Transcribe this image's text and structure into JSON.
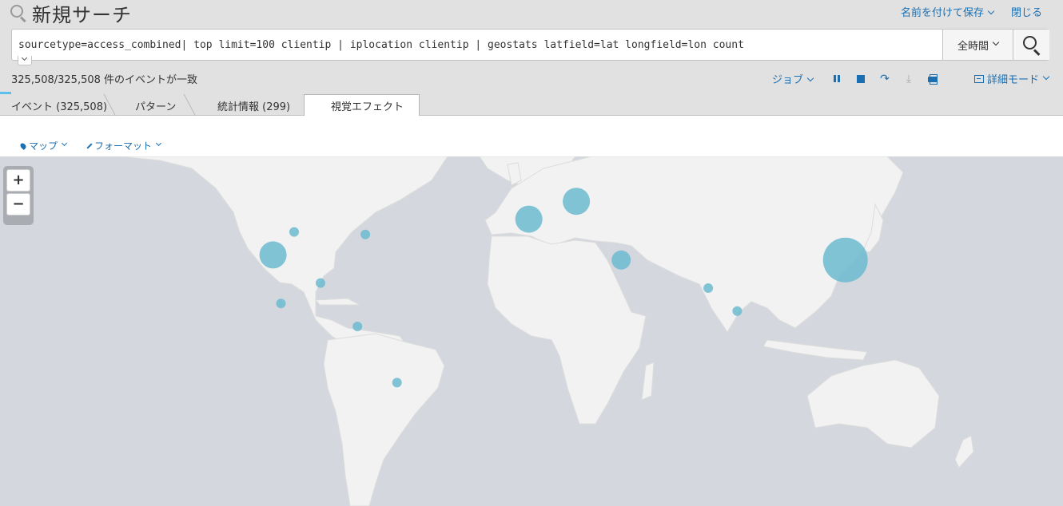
{
  "header": {
    "title": "新規サーチ",
    "save_as": "名前を付けて保存",
    "close": "閉じる"
  },
  "search": {
    "query": "sourcetype=access_combined| top limit=100 clientip | iplocation clientip | geostats latfield=lat longfield=lon count",
    "time_range": "全時間"
  },
  "status": {
    "event_count": "325,508/325,508 件のイベントが一致"
  },
  "job_bar": {
    "job": "ジョブ",
    "mode": "詳細モード"
  },
  "tabs": [
    {
      "label": "イベント (325,508)"
    },
    {
      "label": "パターン"
    },
    {
      "label": "統計情報 (299)"
    },
    {
      "label": "視覚エフェクト"
    }
  ],
  "viz_toolbar": {
    "map": "マップ",
    "format": "フォーマット"
  },
  "map": {
    "zoom_in": "+",
    "zoom_out": "−",
    "colors": {
      "ocean": "#d4d8de",
      "land": "#f2f2f2",
      "marker": "#6cbbd0"
    }
  },
  "chart_data": {
    "type": "scatter",
    "markers": [
      {
        "lon": -98,
        "lat": 38,
        "size": "large"
      },
      {
        "lon": -90,
        "lat": 47,
        "size": "small"
      },
      {
        "lon": -63,
        "lat": 46,
        "size": "small"
      },
      {
        "lon": -95,
        "lat": 19,
        "size": "small"
      },
      {
        "lon": -80,
        "lat": 27,
        "size": "small"
      },
      {
        "lon": -66,
        "lat": 10,
        "size": "small"
      },
      {
        "lon": -51,
        "lat": -12,
        "size": "small"
      },
      {
        "lon": -1,
        "lat": 52,
        "size": "large"
      },
      {
        "lon": 17,
        "lat": 59,
        "size": "large"
      },
      {
        "lon": 34,
        "lat": 36,
        "size": "medium"
      },
      {
        "lon": 67,
        "lat": 25,
        "size": "small"
      },
      {
        "lon": 78,
        "lat": 16,
        "size": "small"
      },
      {
        "lon": 119,
        "lat": 36,
        "size": "xlarge"
      }
    ]
  }
}
